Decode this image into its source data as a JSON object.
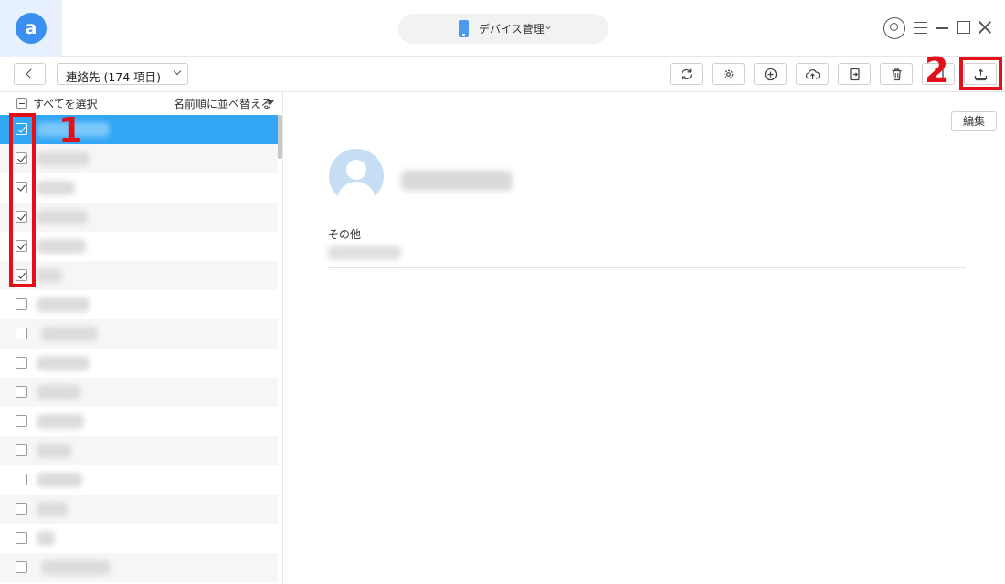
{
  "titlebar": {
    "logo_letter": "a",
    "device_label": "デバイス管理",
    "device_chevron": "⌄"
  },
  "toolbar": {
    "category_label": "連絡先 (174 項目)",
    "buttons": [
      {
        "name": "refresh-button",
        "icon": "refresh-icon"
      },
      {
        "name": "settings-button",
        "icon": "gear-icon"
      },
      {
        "name": "add-button",
        "icon": "plus-circle-icon"
      },
      {
        "name": "upload-cloud-button",
        "icon": "cloud-upload-icon"
      },
      {
        "name": "export-to-device-button",
        "icon": "export-icon"
      },
      {
        "name": "delete-button",
        "icon": "trash-icon"
      },
      {
        "name": "to-device-button",
        "icon": "device-icon"
      },
      {
        "name": "to-computer-button",
        "icon": "download-to-pc-icon"
      }
    ]
  },
  "list": {
    "select_all_label": "すべてを選択",
    "sort_label": "名前順に並べ替える",
    "rows": [
      {
        "checked": true,
        "selected": true
      },
      {
        "checked": true,
        "selected": false
      },
      {
        "checked": true,
        "selected": false
      },
      {
        "checked": true,
        "selected": false
      },
      {
        "checked": true,
        "selected": false
      },
      {
        "checked": true,
        "selected": false
      },
      {
        "checked": false,
        "selected": false
      },
      {
        "checked": false,
        "selected": false
      },
      {
        "checked": false,
        "selected": false
      },
      {
        "checked": false,
        "selected": false
      },
      {
        "checked": false,
        "selected": false
      },
      {
        "checked": false,
        "selected": false
      },
      {
        "checked": false,
        "selected": false
      },
      {
        "checked": false,
        "selected": false
      },
      {
        "checked": false,
        "selected": false
      },
      {
        "checked": false,
        "selected": false
      }
    ]
  },
  "detail": {
    "edit_label": "編集",
    "other_label": "その他"
  },
  "annotations": {
    "step1": "1",
    "step2": "2"
  },
  "colors": {
    "accent": "#32a7f6",
    "annotation": "#e3101a",
    "logo": "#3b8ff0"
  }
}
